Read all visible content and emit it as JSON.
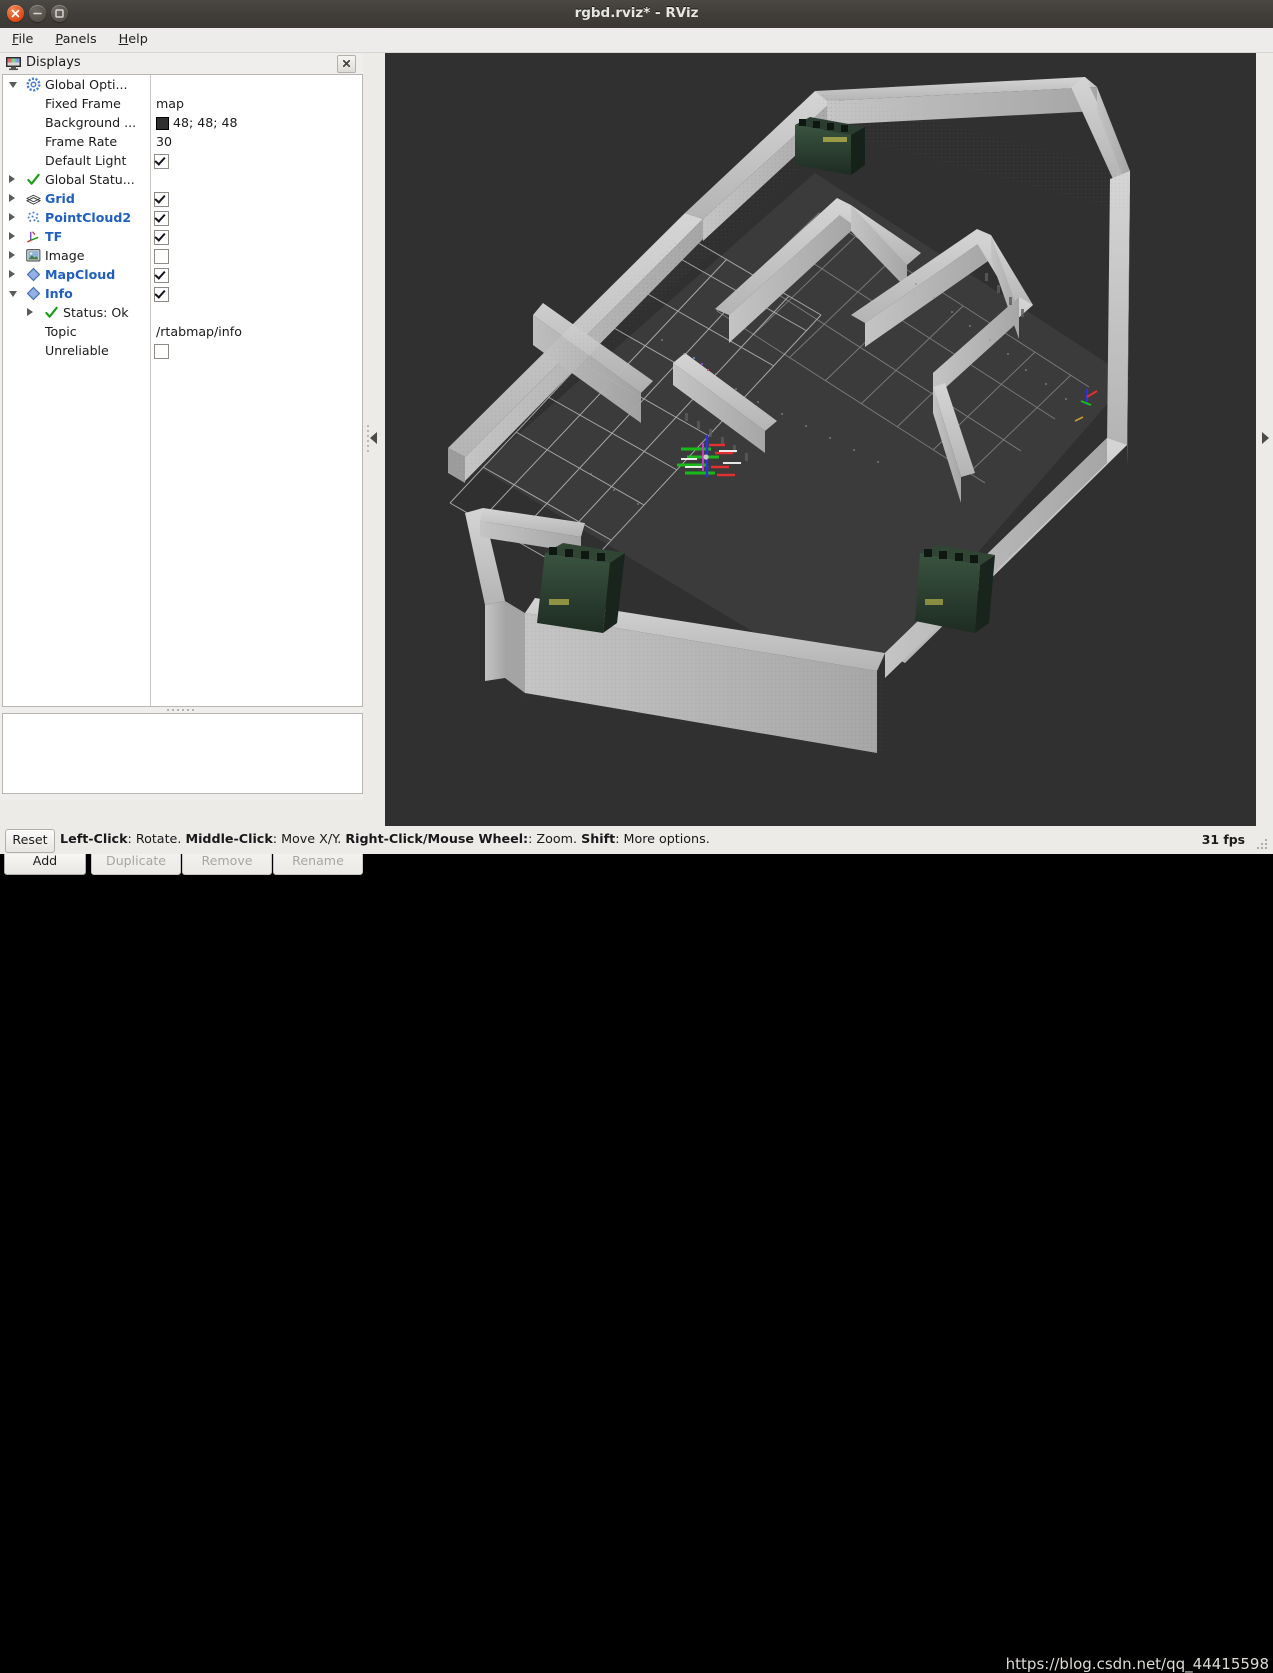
{
  "window": {
    "title": "rgbd.rviz* - RViz",
    "buttons": {
      "close": "close-window",
      "minimize": "minimize-window",
      "maximize": "maximize-window"
    }
  },
  "menu": {
    "items": [
      {
        "label": "File",
        "mnemonic": "F"
      },
      {
        "label": "Panels",
        "mnemonic": "P"
      },
      {
        "label": "Help",
        "mnemonic": "H"
      }
    ]
  },
  "displays_panel": {
    "title": "Displays",
    "close_label": "×",
    "tree": [
      {
        "indent": 0,
        "arrow": "expanded",
        "icon": "gear-icon",
        "label": "Global Opti...",
        "bold": false,
        "value_type": "none"
      },
      {
        "indent": 1,
        "arrow": "none",
        "icon": "none",
        "label": "Fixed Frame",
        "bold": false,
        "value_type": "text",
        "value": "map"
      },
      {
        "indent": 1,
        "arrow": "none",
        "icon": "none",
        "label": "Background ...",
        "bold": false,
        "value_type": "color",
        "value": "48; 48; 48",
        "color": "#303030"
      },
      {
        "indent": 1,
        "arrow": "none",
        "icon": "none",
        "label": "Frame Rate",
        "bold": false,
        "value_type": "text",
        "value": "30"
      },
      {
        "indent": 1,
        "arrow": "none",
        "icon": "none",
        "label": "Default Light",
        "bold": false,
        "value_type": "checkbox",
        "checked": true
      },
      {
        "indent": 0,
        "arrow": "collapsed",
        "icon": "check-icon",
        "label": "Global Statu...",
        "bold": false,
        "value_type": "none"
      },
      {
        "indent": 0,
        "arrow": "collapsed",
        "icon": "grid-icon",
        "label": "Grid",
        "bold": true,
        "value_type": "checkbox",
        "checked": true
      },
      {
        "indent": 0,
        "arrow": "collapsed",
        "icon": "pointcloud-icon",
        "label": "PointCloud2",
        "bold": true,
        "value_type": "checkbox",
        "checked": true
      },
      {
        "indent": 0,
        "arrow": "collapsed",
        "icon": "tf-axes-icon",
        "label": "TF",
        "bold": true,
        "value_type": "checkbox",
        "checked": true
      },
      {
        "indent": 0,
        "arrow": "collapsed",
        "icon": "image-icon",
        "label": "Image",
        "bold": false,
        "value_type": "checkbox",
        "checked": false
      },
      {
        "indent": 0,
        "arrow": "collapsed",
        "icon": "mapcloud-icon",
        "label": "MapCloud",
        "bold": true,
        "value_type": "checkbox",
        "checked": true
      },
      {
        "indent": 0,
        "arrow": "expanded",
        "icon": "info-icon",
        "label": "Info",
        "bold": true,
        "value_type": "checkbox",
        "checked": true
      },
      {
        "indent": 1,
        "arrow": "collapsed",
        "icon": "check-icon",
        "label": "Status: Ok",
        "bold": false,
        "value_type": "none"
      },
      {
        "indent": 1,
        "arrow": "none",
        "icon": "none",
        "label": "Topic",
        "bold": false,
        "value_type": "text",
        "value": "/rtabmap/info"
      },
      {
        "indent": 1,
        "arrow": "none",
        "icon": "none",
        "label": "Unreliable",
        "bold": false,
        "value_type": "checkbox",
        "checked": false
      }
    ],
    "buttons": [
      {
        "label": "Add",
        "enabled": true
      },
      {
        "label": "Duplicate",
        "enabled": false
      },
      {
        "label": "Remove",
        "enabled": false
      },
      {
        "label": "Rename",
        "enabled": false
      }
    ]
  },
  "statusbar": {
    "reset_label": "Reset",
    "hint_parts": [
      {
        "text": "Left-Click",
        "bold": true
      },
      {
        "text": ": Rotate. ",
        "bold": false
      },
      {
        "text": "Middle-Click",
        "bold": true
      },
      {
        "text": ": Move X/Y. ",
        "bold": false
      },
      {
        "text": "Right-Click/Mouse Wheel:",
        "bold": true
      },
      {
        "text": ": Zoom. ",
        "bold": false
      },
      {
        "text": "Shift",
        "bold": true
      },
      {
        "text": ": More options.",
        "bold": false
      }
    ],
    "fps": "31 fps"
  },
  "watermark": "https://blog.csdn.net/qq_44415598",
  "render_view": {
    "background_color": "#303030",
    "grid_color": "#b9b9b9",
    "wall_color": "#c9c9c9",
    "floor_color": "#3a3a3a",
    "furniture_color": "#2d4031",
    "description": "3D RTAB-Map point cloud of an indoor floor plan seen from above with grid plane, white walls, dark floor, green furniture clusters and a TF axes marker near the centre"
  }
}
